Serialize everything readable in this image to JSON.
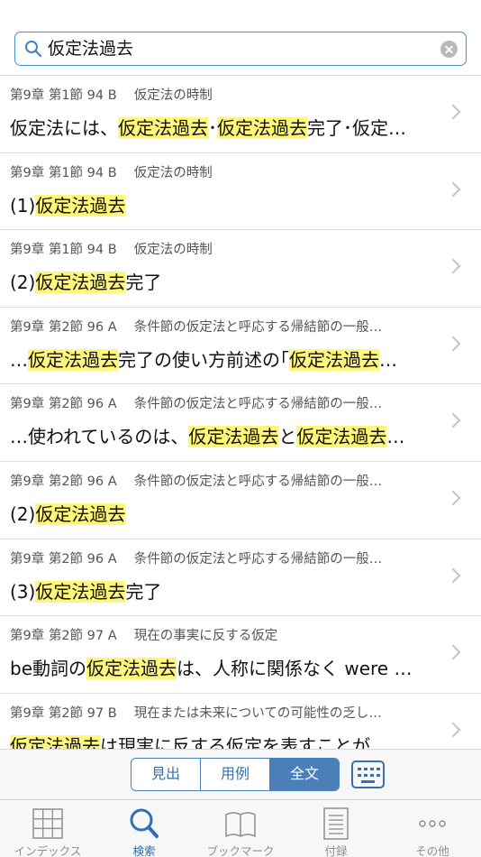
{
  "search": {
    "query": "仮定法過去"
  },
  "results": [
    {
      "meta": "第9章 第1節 94 B　 仮定法の時制",
      "segments": [
        {
          "t": "仮定法には、",
          "h": false
        },
        {
          "t": "仮定法過去",
          "h": true
        },
        {
          "t": "･",
          "h": false
        },
        {
          "t": "仮定法過去",
          "h": true
        },
        {
          "t": "完了･仮定…",
          "h": false
        }
      ]
    },
    {
      "meta": "第9章 第1節 94 B　 仮定法の時制",
      "segments": [
        {
          "t": "(1)",
          "h": false
        },
        {
          "t": "仮定法過去",
          "h": true
        }
      ]
    },
    {
      "meta": "第9章 第1節 94 B　 仮定法の時制",
      "segments": [
        {
          "t": "(2)",
          "h": false
        },
        {
          "t": "仮定法過去",
          "h": true
        },
        {
          "t": "完了",
          "h": false
        }
      ]
    },
    {
      "meta": "第9章 第2節 96 A　 条件節の仮定法と呼応する帰結節の一般…",
      "segments": [
        {
          "t": "…",
          "h": false
        },
        {
          "t": "仮定法過去",
          "h": true
        },
        {
          "t": "完了の使い方前述の｢",
          "h": false
        },
        {
          "t": "仮定法過去",
          "h": true
        },
        {
          "t": "…",
          "h": false
        }
      ]
    },
    {
      "meta": "第9章 第2節 96 A　 条件節の仮定法と呼応する帰結節の一般…",
      "segments": [
        {
          "t": "…使われているのは、",
          "h": false
        },
        {
          "t": "仮定法過去",
          "h": true
        },
        {
          "t": "と",
          "h": false
        },
        {
          "t": "仮定法過去",
          "h": true
        },
        {
          "t": "…",
          "h": false
        }
      ]
    },
    {
      "meta": "第9章 第2節 96 A　 条件節の仮定法と呼応する帰結節の一般…",
      "segments": [
        {
          "t": "(2)",
          "h": false
        },
        {
          "t": "仮定法過去",
          "h": true
        }
      ]
    },
    {
      "meta": "第9章 第2節 96 A　 条件節の仮定法と呼応する帰結節の一般…",
      "segments": [
        {
          "t": "(3)",
          "h": false
        },
        {
          "t": "仮定法過去",
          "h": true
        },
        {
          "t": "完了",
          "h": false
        }
      ]
    },
    {
      "meta": "第9章 第2節 97 A　 現在の事実に反する仮定",
      "segments": [
        {
          "t": "be動詞の",
          "h": false
        },
        {
          "t": "仮定法過去",
          "h": true
        },
        {
          "t": "は、人称に関係なく were …",
          "h": false
        }
      ]
    },
    {
      "meta": "第9章 第2節 97 B　 現在または未来についての可能性の乏し…",
      "segments": [
        {
          "t": "仮定法過去",
          "h": true
        },
        {
          "t": "は現実に反する仮定を表すことが",
          "h": false
        }
      ]
    }
  ],
  "segment": {
    "options": [
      "見出",
      "用例",
      "全文"
    ],
    "selected": "全文"
  },
  "tabs": [
    {
      "label": "インデックス",
      "icon": "grid-icon"
    },
    {
      "label": "検索",
      "icon": "search-icon"
    },
    {
      "label": "ブックマーク",
      "icon": "book-icon"
    },
    {
      "label": "付録",
      "icon": "document-icon"
    },
    {
      "label": "その他",
      "icon": "more-icon"
    }
  ],
  "colors": {
    "accent": "#2f6fb3",
    "highlight": "#fff77a",
    "segment": "#4a7fb8"
  }
}
